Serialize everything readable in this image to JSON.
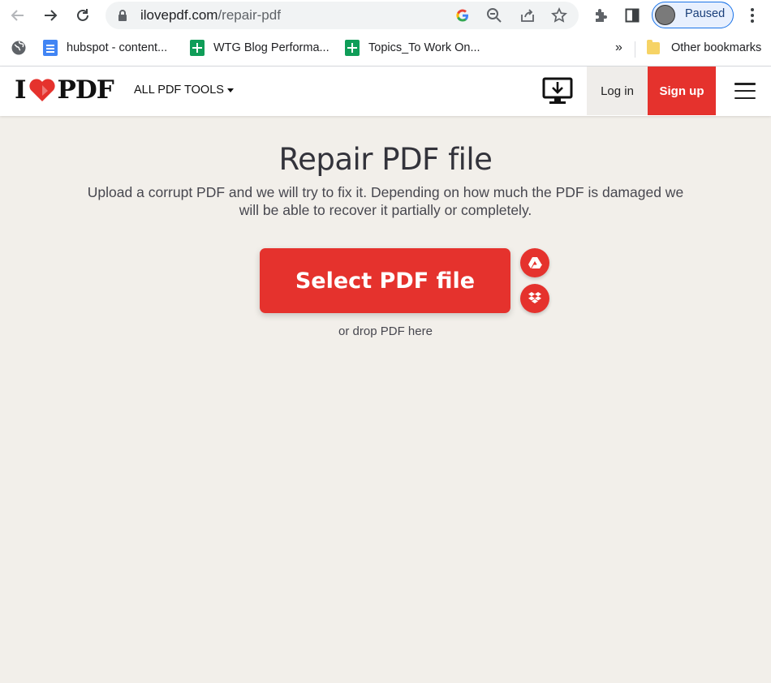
{
  "browser": {
    "url_host": "ilovepdf.com",
    "url_path": "/repair-pdf",
    "profile_label": "Paused"
  },
  "bookmarks": [
    {
      "label": "hubspot - content...",
      "icon": "google-docs-icon"
    },
    {
      "label": "WTG Blog Performa...",
      "icon": "google-sheets-icon"
    },
    {
      "label": "Topics_To Work On...",
      "icon": "google-sheets-icon"
    }
  ],
  "bookmarks_overflow": "»",
  "other_bookmarks": "Other bookmarks",
  "site": {
    "logo_left": "I",
    "logo_right": "PDF",
    "tools_menu": "ALL PDF TOOLS",
    "login": "Log in",
    "signup": "Sign up",
    "brand_color": "#e5322d"
  },
  "main": {
    "title": "Repair PDF file",
    "subtitle_line1": "Upload a corrupt PDF and we will try to fix it. Depending on how much the PDF is damaged we",
    "subtitle_line2": "will be able to recover it partially or completely.",
    "select_button": "Select PDF file",
    "drop_text": "or drop PDF here"
  }
}
